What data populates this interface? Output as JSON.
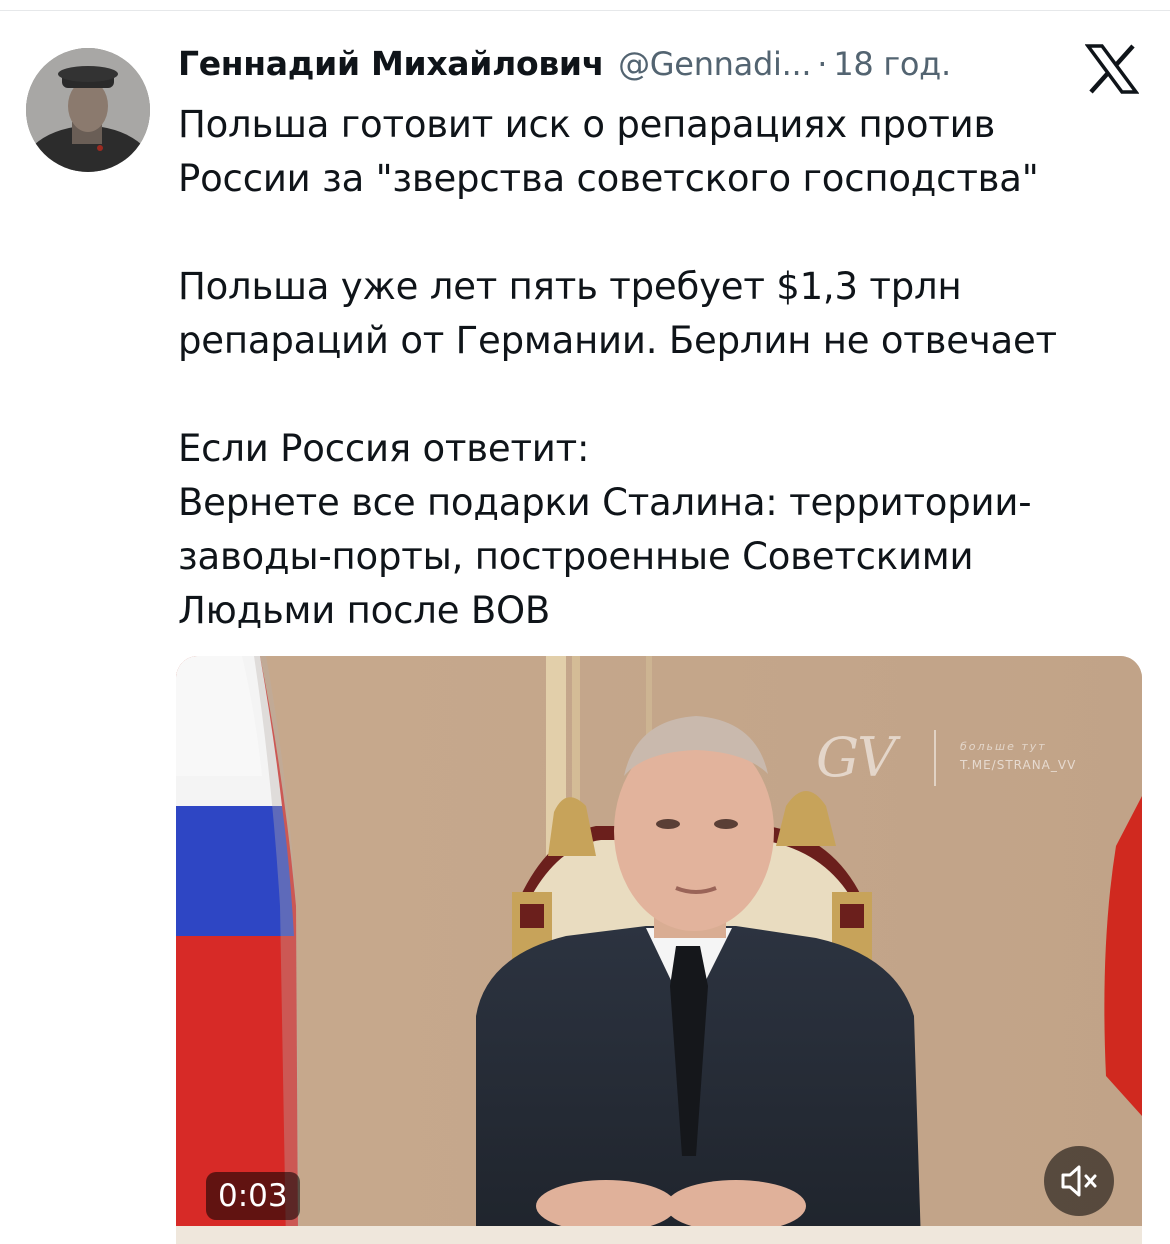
{
  "tweet": {
    "display_name": "Геннадий Михайлович",
    "handle": "@Gennadi...",
    "separator": "·",
    "time": "18 год.",
    "paragraphs": [
      "Польша готовит иск о репарациях против России за \"зверства советского господства\"",
      "Польша уже лет пять требует $1,3 трлн репараций от Германии. Берлин не отвечает",
      "Если Россия ответит:\nВернете все подарки Сталина: территории-заводы-порты, построенные Советскими Людьми после ВОВ"
    ]
  },
  "media": {
    "timestamp": "0:03",
    "watermark_logo": "GV",
    "watermark_tagline": "больше тут",
    "watermark_url": "T.ME/STRANA_VV"
  },
  "icons": {
    "brand": "x-logo-icon",
    "mute": "speaker-muted-icon"
  },
  "colors": {
    "text": "#0f1419",
    "secondary": "#536471"
  }
}
